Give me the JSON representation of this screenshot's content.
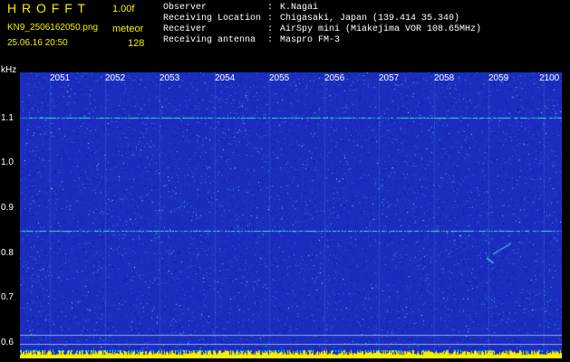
{
  "header": {
    "app_title": "H R O F F T",
    "version": "1.00f",
    "filename": "KN9_2506162050.png",
    "mode": "meteor",
    "datetime": "25.06.16 20:50",
    "fft_size": "128"
  },
  "metadata": [
    {
      "key": "Observer",
      "value": "K.Nagai"
    },
    {
      "key": "Receiving Location",
      "value": "Chigasaki, Japan (139.414 35.340)"
    },
    {
      "key": "Receiver",
      "value": "AirSpy mini (Miakejima VOR 108.65MHz)"
    },
    {
      "key": "Receiving antenna",
      "value": "Maspro FM-3"
    }
  ],
  "separator": ":",
  "axis": {
    "y_unit": "kHz",
    "y_ticks": [
      "1.1",
      "1.0",
      "0.9",
      "0.8",
      "0.7",
      "0.6"
    ],
    "x_ticks": [
      "2051",
      "2052",
      "2053",
      "2054",
      "2055",
      "2056",
      "2057",
      "2058",
      "2059",
      "2100"
    ]
  },
  "colors": {
    "background": "#1a2dbf",
    "header_text": "#f5f000",
    "carrier_line": "#40e0d0",
    "baseline_bar": "#f5f000"
  }
}
